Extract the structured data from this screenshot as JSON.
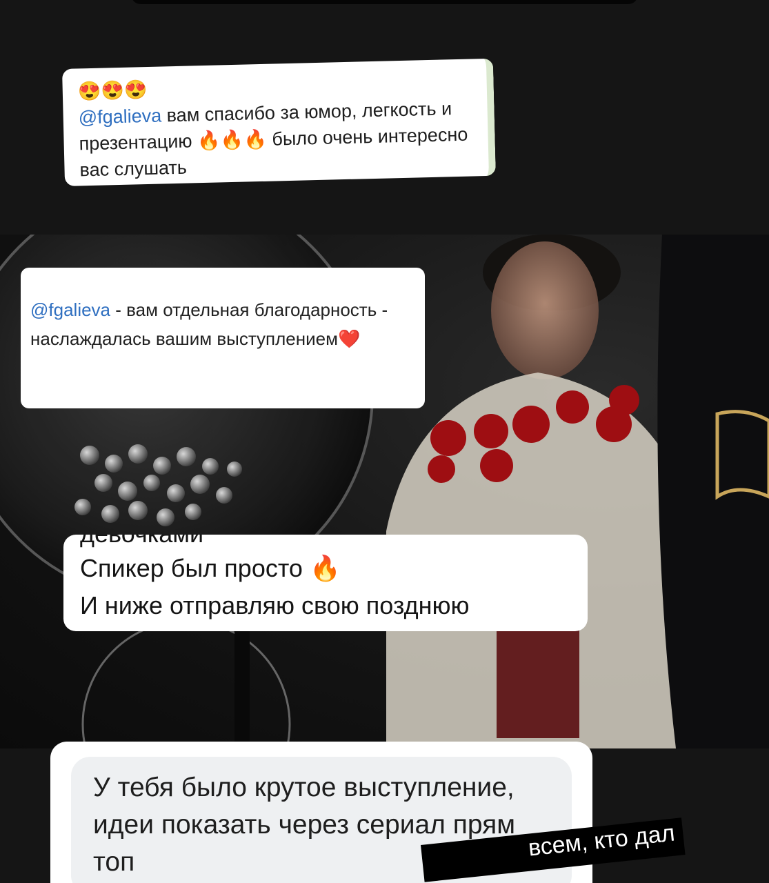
{
  "comment1": {
    "emoji_row": "😍😍😍",
    "mention": "@fgalieva",
    "text_part1": " вам спасибо за юмор, легкость и презентацию ",
    "fire": "🔥🔥🔥",
    "text_part2": " было очень интересно вас слушать"
  },
  "comment2": {
    "mention": "@fgalieva",
    "text": " - вам отдельная благодарность - наслаждалась вашим выступлением",
    "heart": "❤️"
  },
  "comment3": {
    "cut_line": "девочками",
    "line1": "Спикер был просто ",
    "fire": "🔥",
    "line2": "И ниже отправляю свою позднюю"
  },
  "comment4": {
    "text": "У тебя было крутое выступление, идеи показать через сериал прям топ"
  },
  "caption": {
    "text": "всем, кто дал"
  },
  "colors": {
    "mention": "#2f6fc0",
    "bubble_bg": "#ffffff",
    "inner_bubble": "#eef0f2",
    "background": "#151515"
  }
}
